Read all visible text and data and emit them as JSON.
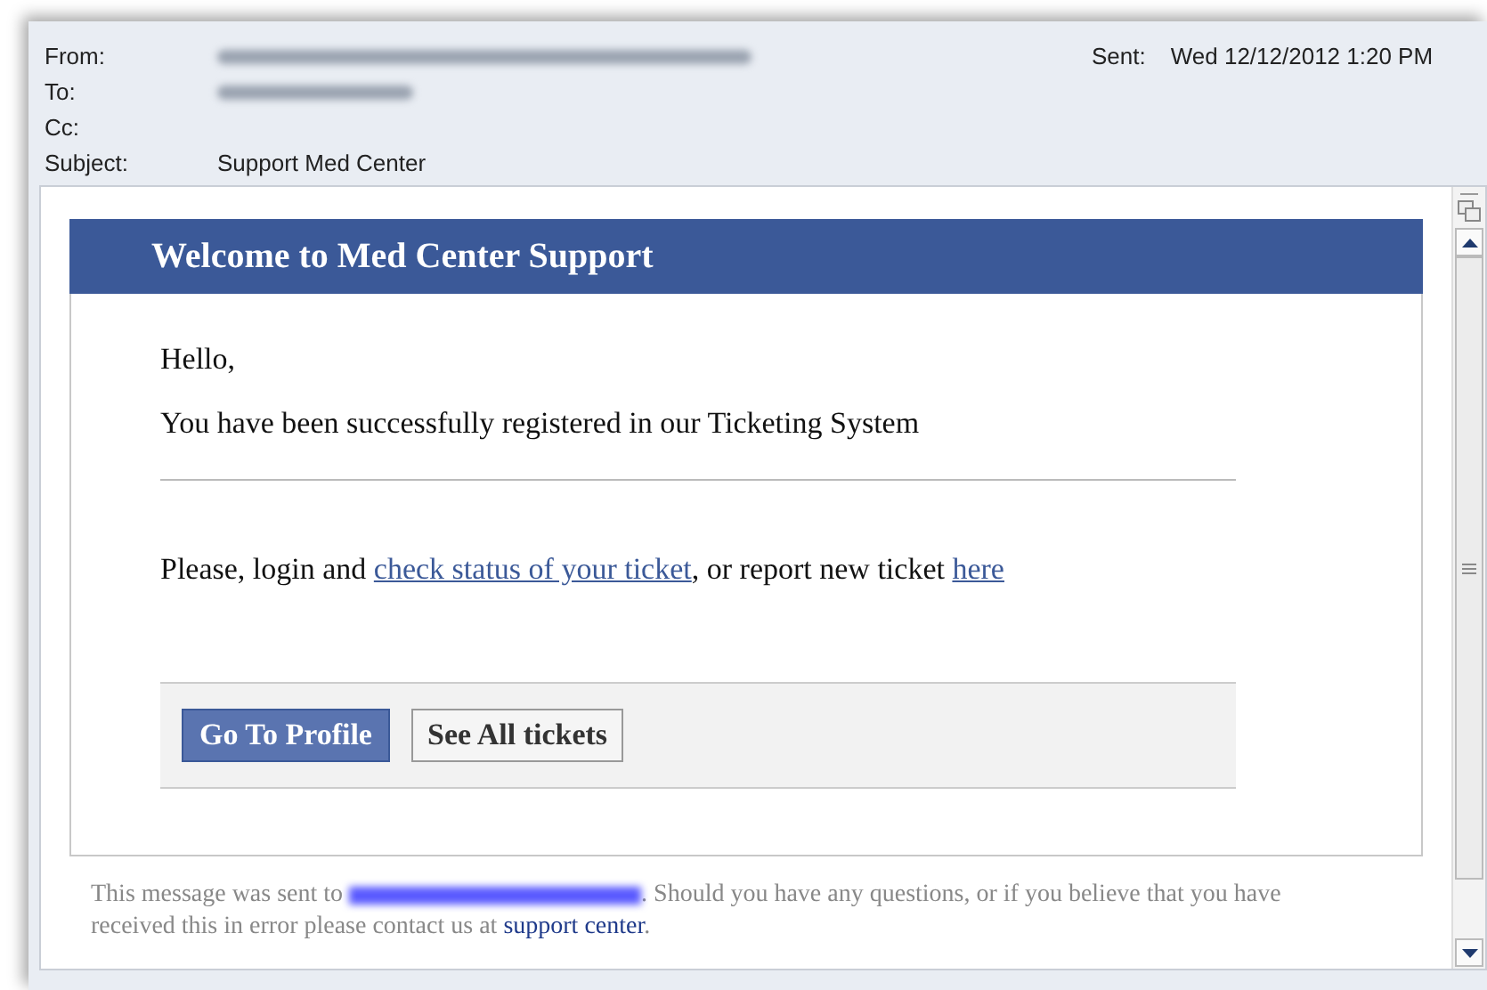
{
  "header": {
    "fields": [
      {
        "label": "From:",
        "redacted": true
      },
      {
        "label": "To:",
        "redacted": true
      },
      {
        "label": "Cc:",
        "redacted": false
      },
      {
        "label": "Subject:",
        "redacted": false,
        "value": "Support Med Center"
      }
    ],
    "sent_label": "Sent:",
    "sent_value": "Wed 12/12/2012 1:20 PM"
  },
  "email": {
    "banner": "Welcome to Med Center Support",
    "greeting": "Hello,",
    "intro": "You have been successfully registered in our Ticketing System",
    "login_parts": [
      {
        "kind": "text",
        "text": "Please, login and "
      },
      {
        "kind": "link",
        "text": "check status of your ticket"
      },
      {
        "kind": "text",
        "text": ", or report new ticket "
      },
      {
        "kind": "link",
        "text": "here"
      }
    ],
    "buttons": [
      {
        "label": "Go To Profile",
        "primary": true
      },
      {
        "label": "See All tickets",
        "primary": false
      }
    ],
    "footer_parts": [
      {
        "kind": "text",
        "text": "This message was sent to "
      },
      {
        "kind": "redacted"
      },
      {
        "kind": "text",
        "text": ". Should you have any questions, or if you believe that you have received this in error please contact us at "
      },
      {
        "kind": "link",
        "text": "support center"
      },
      {
        "kind": "text",
        "text": "."
      }
    ]
  }
}
